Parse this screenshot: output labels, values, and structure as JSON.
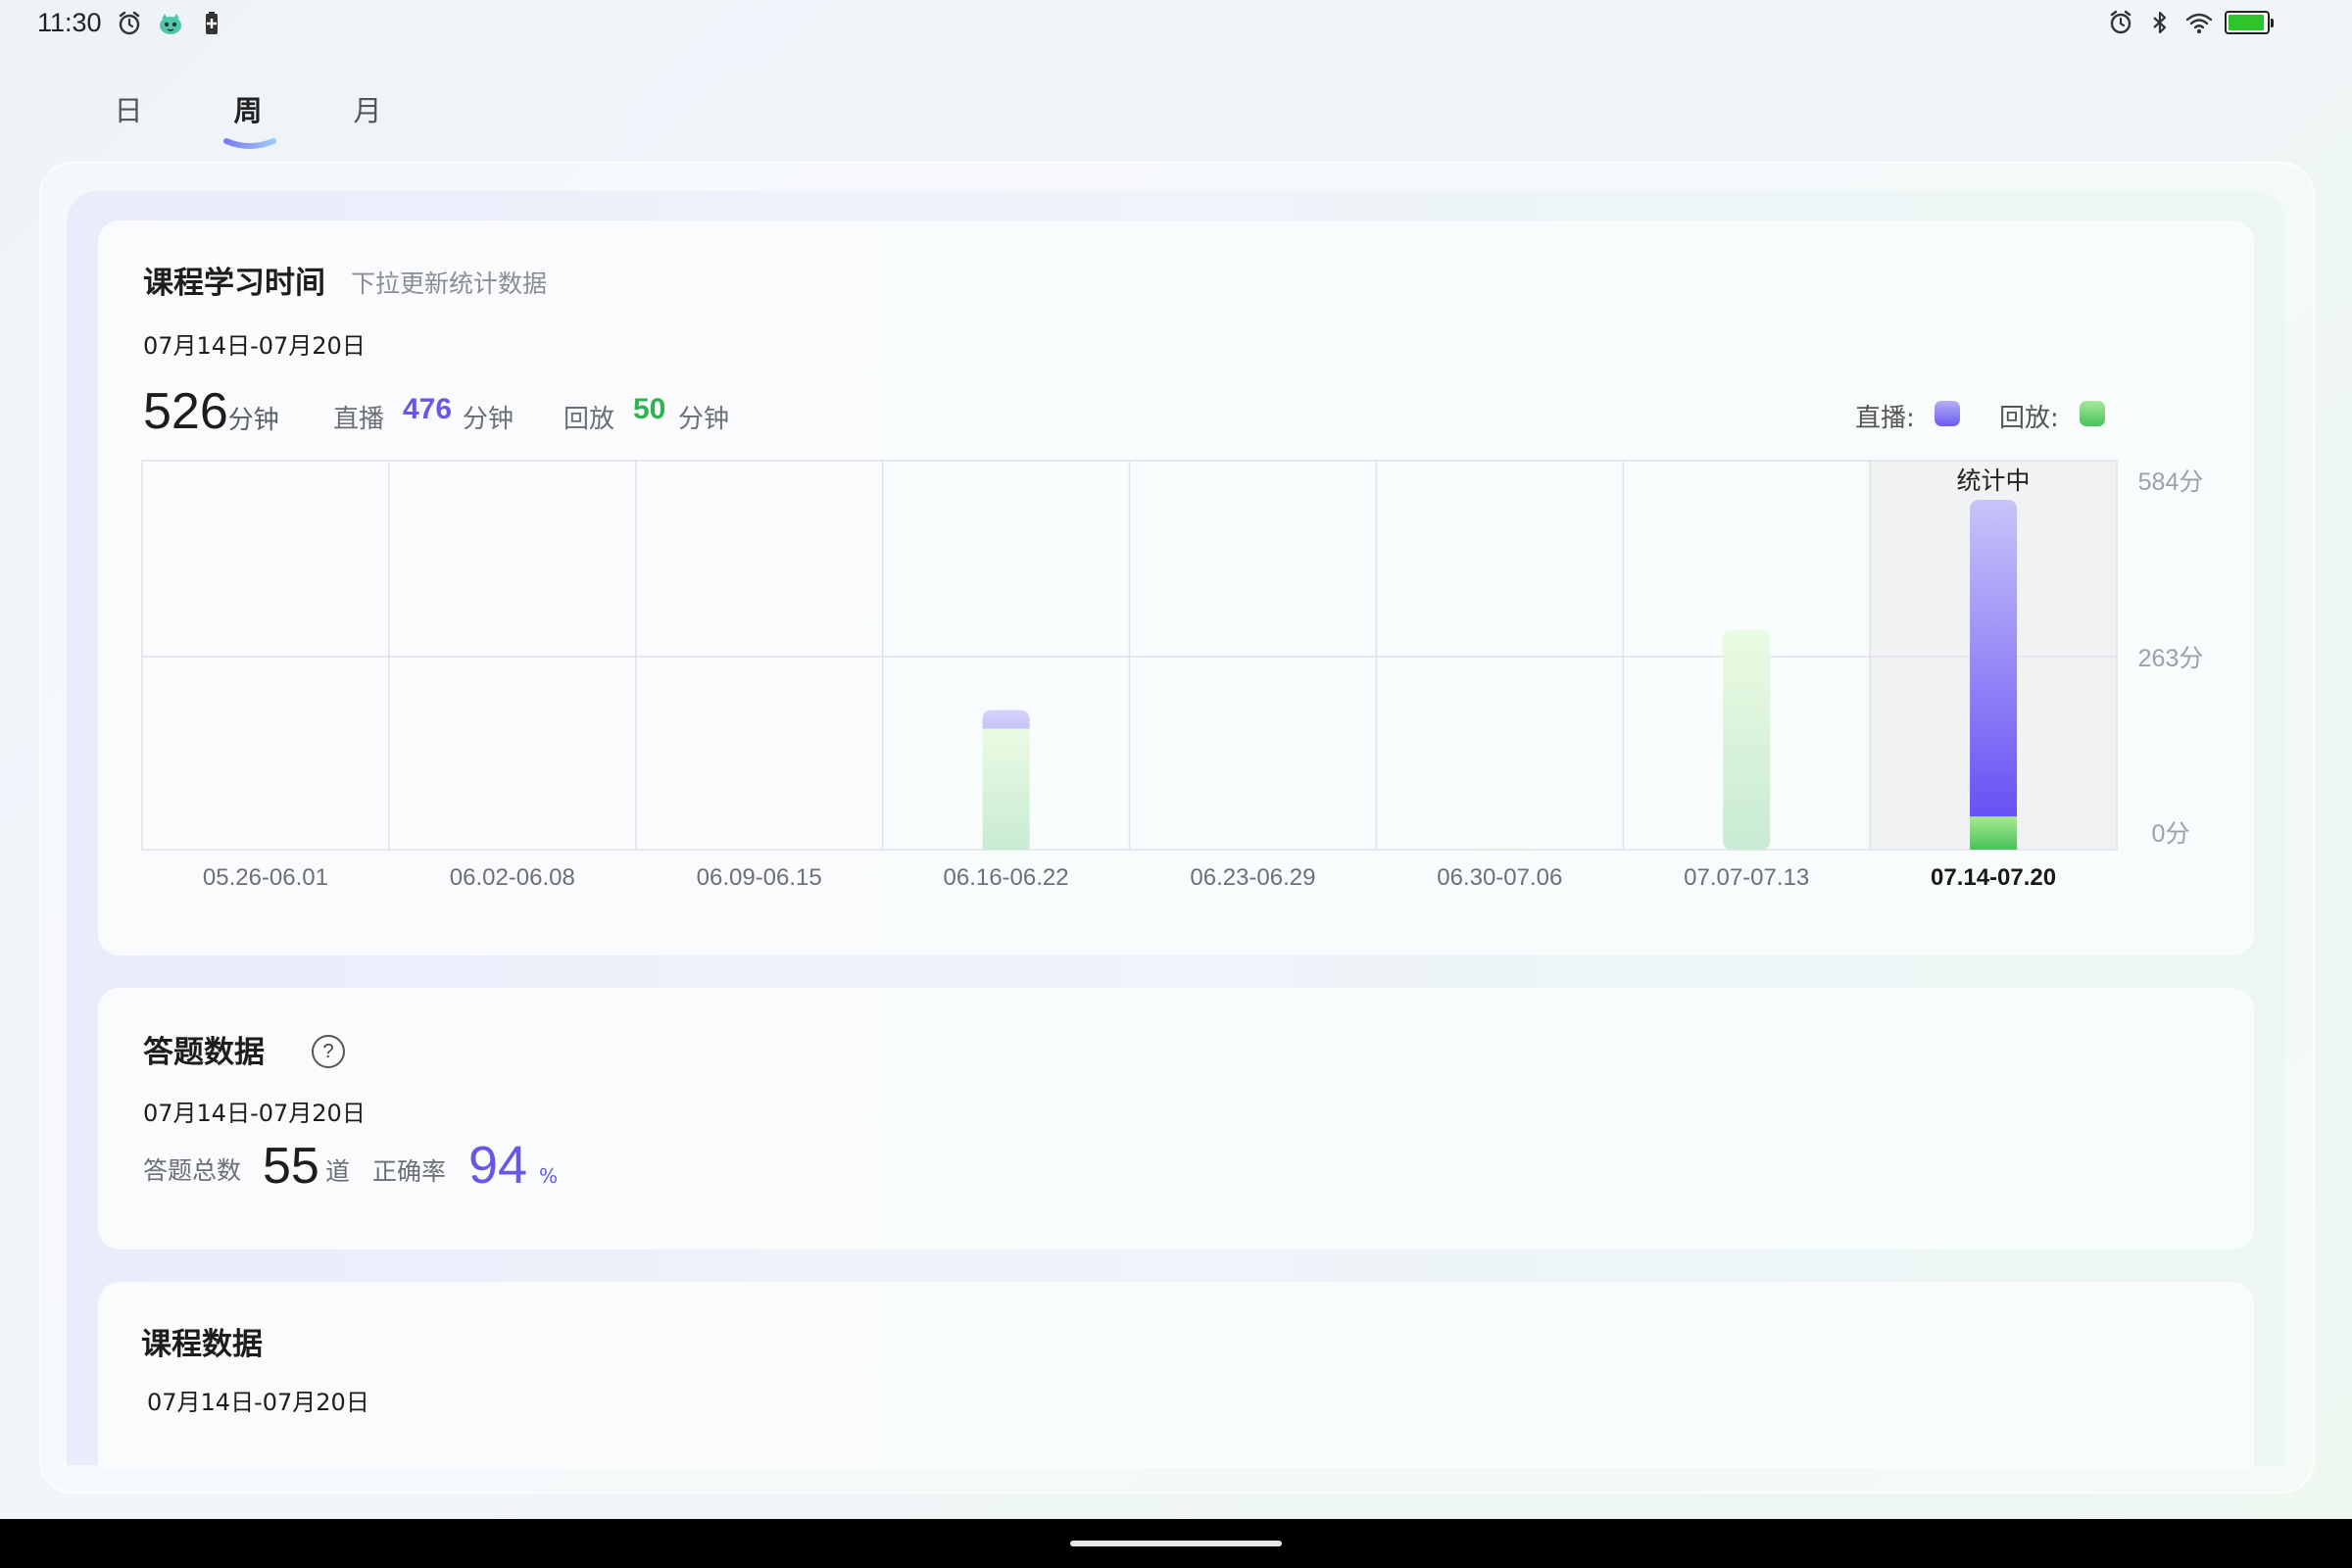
{
  "status_bar": {
    "time": "11:30",
    "left_icons": [
      "alarm-icon",
      "app-mascot-icon",
      "battery-saver-icon"
    ],
    "right_icons": [
      "alarm-icon",
      "bluetooth-icon",
      "wifi-icon"
    ],
    "battery_level": 1.0
  },
  "tabs": [
    {
      "label": "日",
      "active": false
    },
    {
      "label": "周",
      "active": true
    },
    {
      "label": "月",
      "active": false
    }
  ],
  "study_card": {
    "title": "课程学习时间",
    "hint": "下拉更新统计数据",
    "date_range": "07月14日-07月20日",
    "total": "526",
    "total_unit": "分钟",
    "live_label": "直播",
    "live_value": "476",
    "live_unit": "分钟",
    "replay_label": "回放",
    "replay_value": "50",
    "replay_unit": "分钟",
    "legend_live": "直播:",
    "legend_replay": "回放:",
    "colors": {
      "live": "#6b5cf0",
      "replay": "#4ccb63",
      "live_value_text": "#6658e6",
      "replay_value_text": "#2fb350"
    }
  },
  "chart_data": {
    "type": "bar",
    "stacked": true,
    "categories": [
      "05.26-06.01",
      "06.02-06.08",
      "06.09-06.15",
      "06.16-06.22",
      "06.23-06.29",
      "06.30-07.06",
      "07.07-07.13",
      "07.14-07.20"
    ],
    "series": [
      {
        "name": "回放",
        "values": [
          0,
          0,
          0,
          182,
          0,
          2,
          330,
          50
        ]
      },
      {
        "name": "直播",
        "values": [
          0,
          0,
          0,
          28,
          0,
          0,
          0,
          476
        ]
      }
    ],
    "y_ticks": [
      "584分",
      "263分",
      "0分"
    ],
    "ylim": [
      0,
      526
    ],
    "current_index": 7,
    "current_note": "统计中",
    "grid": true
  },
  "answer_card": {
    "title": "答题数据",
    "date_range": "07月14日-07月20日",
    "total_label": "答题总数",
    "total_value": "55",
    "total_unit": "道",
    "accuracy_label": "正确率",
    "accuracy_value": "94",
    "accuracy_unit": "%",
    "help_glyph": "?"
  },
  "course_card": {
    "title": "课程数据",
    "date_range": "07月14日-07月20日"
  }
}
